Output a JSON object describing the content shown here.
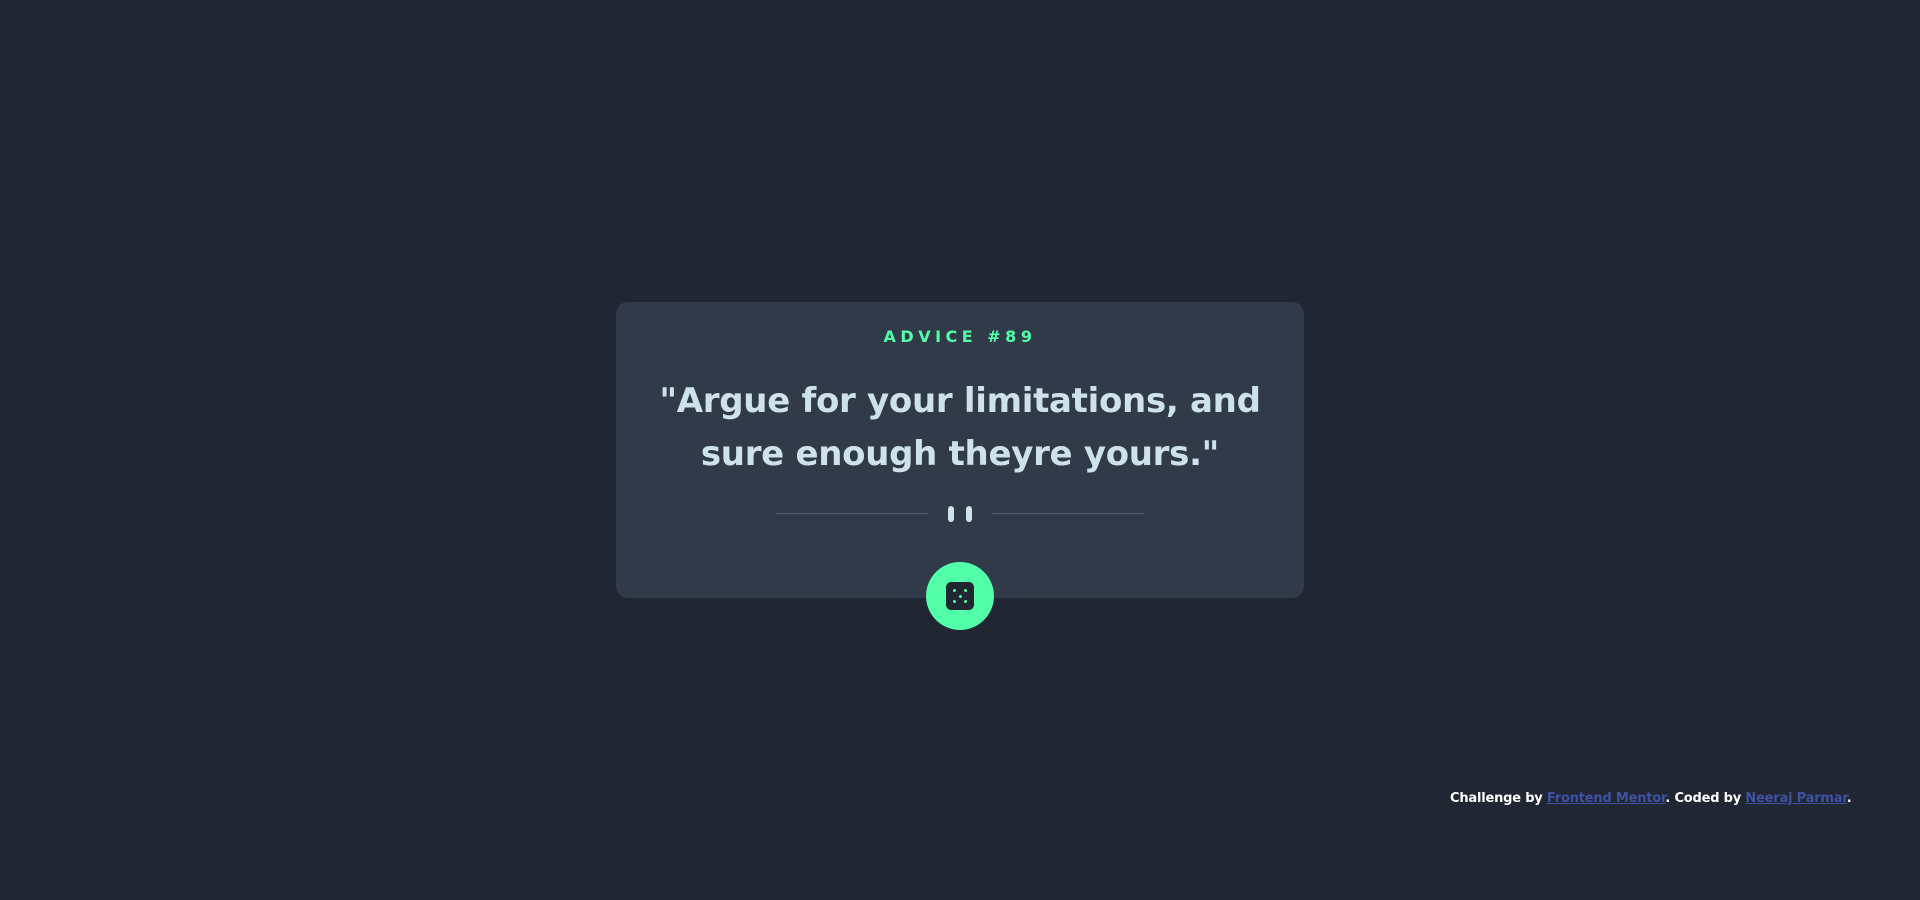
{
  "card": {
    "advice_label": "ADVICE #89",
    "quote": "\"Argue for your limitations, and sure enough theyre yours.\""
  },
  "divider": {
    "icon": "pause-icon"
  },
  "dice_button": {
    "icon": "dice-icon"
  },
  "footer": {
    "challenge_text": "Challenge by ",
    "challenge_link": "Frontend Mentor",
    "coded_text": ". Coded by ",
    "author_link": "Neeraj Parmar",
    "end_text": "."
  },
  "colors": {
    "background": "#202632",
    "card": "#313a49",
    "accent": "#52ffa8",
    "quote_text": "#cee3e9",
    "link": "#3e52a3"
  }
}
